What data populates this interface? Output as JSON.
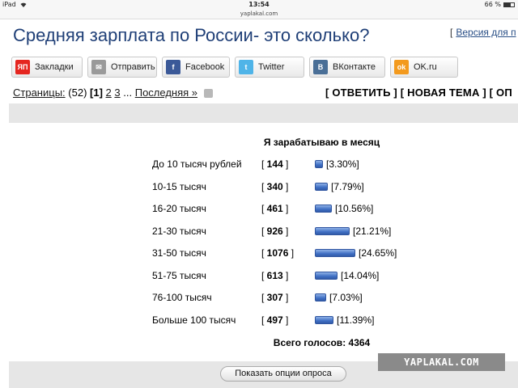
{
  "status_bar": {
    "device": "iPad",
    "time": "13:54",
    "battery": "66 %",
    "battery_level": 0.66
  },
  "url": "yaplakal.com",
  "page": {
    "title": "Средняя зарплата по России- это сколько?",
    "version_prefix": "[",
    "version_link": "Версия для п"
  },
  "share": [
    {
      "label": "Закладки",
      "icon": "yandex-icon",
      "icon_text": "ЯП",
      "color": "#e52620"
    },
    {
      "label": "Отправить",
      "icon": "mail-icon",
      "icon_text": "✉",
      "color": "#9a9a9a"
    },
    {
      "label": "Facebook",
      "icon": "facebook-icon",
      "icon_text": "f",
      "color": "#3b5998"
    },
    {
      "label": "Twitter",
      "icon": "twitter-icon",
      "icon_text": "t",
      "color": "#4fb4e8"
    },
    {
      "label": "ВКонтакте",
      "icon": "vk-icon",
      "icon_text": "B",
      "color": "#4a6f97"
    },
    {
      "label": "OK.ru",
      "icon": "ok-icon",
      "icon_text": "ok",
      "color": "#f39a1e"
    }
  ],
  "pager": {
    "label": "Страницы:",
    "count": "(52)",
    "current": "[1]",
    "p2": "2",
    "p3": "3",
    "ellipsis": "...",
    "last": "Последняя »"
  },
  "actions": "[ ОТВЕТИТЬ ] [ НОВАЯ ТЕМА ] [ ОП",
  "poll": {
    "title": "Я зарабатываю в месяц",
    "total": "Всего голосов: 4364",
    "options": [
      {
        "label": "До 10 тысяч рублей",
        "count": "144",
        "percent": "[3.30%]",
        "value": 3.3
      },
      {
        "label": "10-15 тысяч",
        "count": "340",
        "percent": "[7.79%]",
        "value": 7.79
      },
      {
        "label": "16-20 тысяч",
        "count": "461",
        "percent": "[10.56%]",
        "value": 10.56
      },
      {
        "label": "21-30 тысяч",
        "count": "926",
        "percent": "[21.21%]",
        "value": 21.21
      },
      {
        "label": "31-50 тысяч",
        "count": "1076",
        "percent": "[24.65%]",
        "value": 24.65
      },
      {
        "label": "51-75 тысяч",
        "count": "613",
        "percent": "[14.04%]",
        "value": 14.04
      },
      {
        "label": "76-100 тысяч",
        "count": "307",
        "percent": "[7.03%]",
        "value": 7.03
      },
      {
        "label": "Больше 100 тысяч",
        "count": "497",
        "percent": "[11.39%]",
        "value": 11.39
      }
    ],
    "show_options_button": "Показать опции опроса"
  },
  "watermark": "YAPLAKAL.COM"
}
